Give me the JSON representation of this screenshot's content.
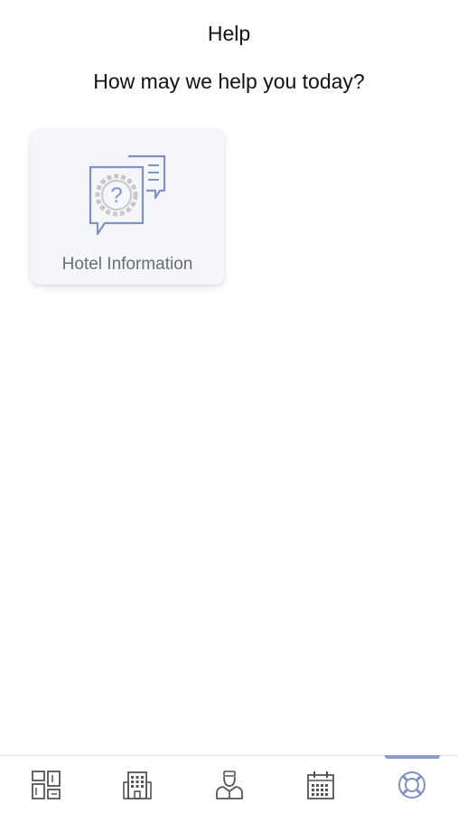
{
  "header": {
    "title": "Help",
    "subtitle": "How may we help you today?"
  },
  "cards": [
    {
      "label": "Hotel Information",
      "icon": "help-chat-icon"
    }
  ],
  "bottom_nav": {
    "items": [
      {
        "icon": "dashboard-icon",
        "active": false
      },
      {
        "icon": "hotel-building-icon",
        "active": false
      },
      {
        "icon": "concierge-icon",
        "active": false
      },
      {
        "icon": "calendar-icon",
        "active": false
      },
      {
        "icon": "lifebuoy-icon",
        "active": true
      }
    ]
  },
  "colors": {
    "icon_gray": "#555555",
    "active_accent": "#8d9bc8",
    "card_background": "#f4f6fa",
    "icon_blue": "#7f92c4"
  }
}
